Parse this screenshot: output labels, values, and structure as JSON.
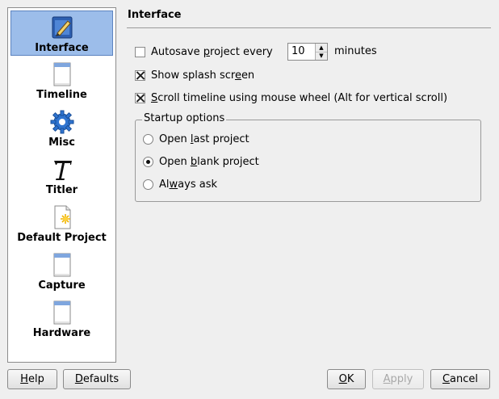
{
  "sidebar": {
    "items": [
      {
        "label": "Interface",
        "icon": "pen-document-icon"
      },
      {
        "label": "Timeline",
        "icon": "page-icon"
      },
      {
        "label": "Misc",
        "icon": "gear-icon"
      },
      {
        "label": "Titler",
        "icon": "text-t-icon"
      },
      {
        "label": "Default Project",
        "icon": "new-document-icon"
      },
      {
        "label": "Capture",
        "icon": "page-icon"
      },
      {
        "label": "Hardware",
        "icon": "page-icon"
      }
    ]
  },
  "page": {
    "title": "Interface",
    "autosave": {
      "pre": "Autosave ",
      "ul": "p",
      "post": "roject every",
      "value": "10",
      "unit": "minutes",
      "checked": false
    },
    "splash": {
      "pre": "Show splash scr",
      "ul": "e",
      "post": "en",
      "checked": true
    },
    "scroll": {
      "pre": "",
      "ul": "S",
      "post": "croll timeline using mouse wheel (Alt for vertical scroll)",
      "checked": true
    },
    "startup": {
      "title": "Startup options",
      "options": [
        {
          "pre": "Open ",
          "ul": "l",
          "post": "ast project",
          "selected": false
        },
        {
          "pre": "Open ",
          "ul": "b",
          "post": "lank project",
          "selected": true
        },
        {
          "pre": "Al",
          "ul": "w",
          "post": "ays ask",
          "selected": false
        }
      ]
    }
  },
  "buttons": {
    "help": {
      "ul": "H",
      "post": "elp"
    },
    "defaults": {
      "ul": "D",
      "post": "efaults"
    },
    "ok": {
      "ul": "O",
      "post": "K"
    },
    "apply": {
      "ul": "A",
      "post": "pply"
    },
    "cancel": {
      "ul": "C",
      "post": "ancel"
    }
  },
  "colors": {
    "selection": "#9cbdea",
    "background": "#efefef"
  }
}
